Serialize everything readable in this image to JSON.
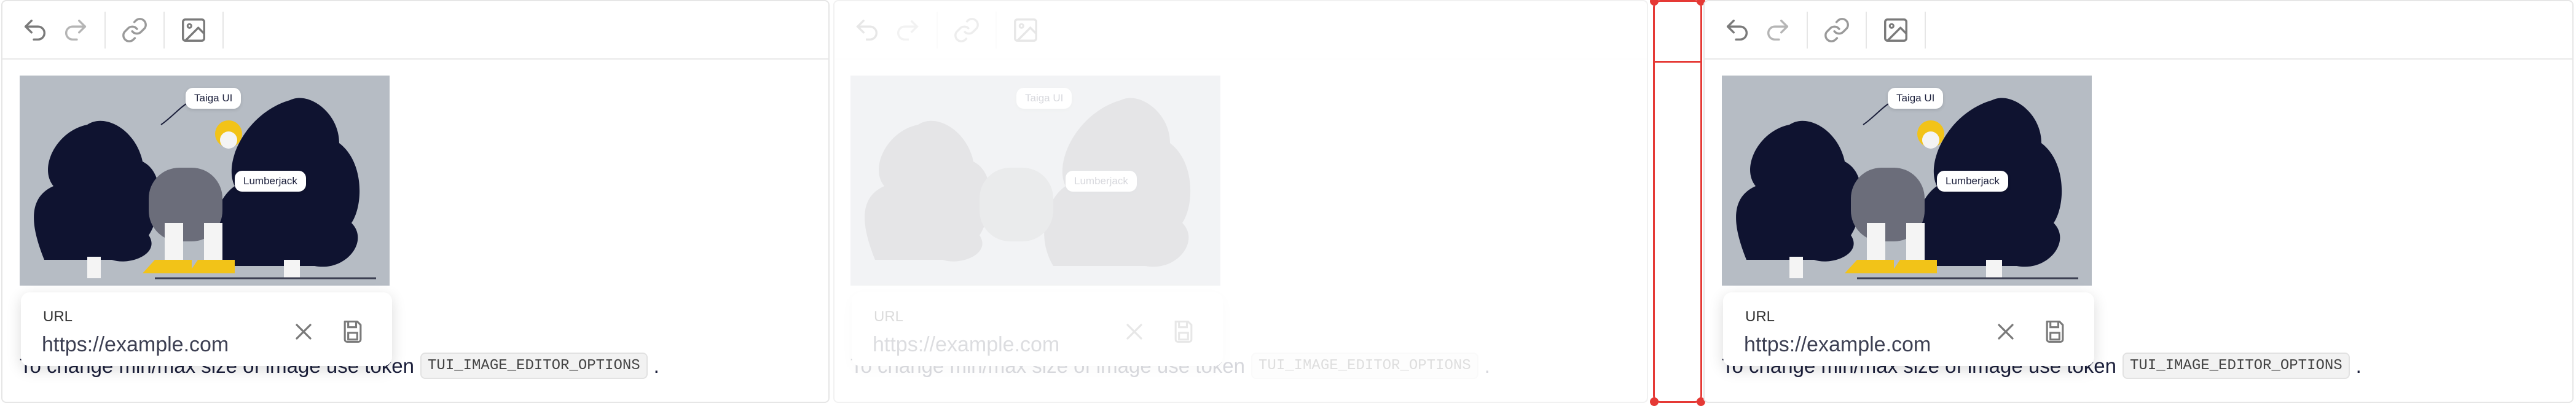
{
  "toolbar": {
    "undo_icon": "undo-icon",
    "redo_icon": "redo-icon",
    "link_icon": "link-icon",
    "image_icon": "image-icon"
  },
  "illustration": {
    "tag_top": "Taiga UI",
    "tag_bottom": "Lumberjack"
  },
  "popup": {
    "label": "URL",
    "value": "https://example.com",
    "close_icon": "close-icon",
    "save_icon": "save-icon"
  },
  "info": {
    "text": "To change min/max size of image use token",
    "token": "TUI_IMAGE_EDITOR_OPTIONS",
    "suffix": "."
  },
  "colors": {
    "accent_red": "#e53935",
    "illustration_bg": "#b6bcc4",
    "tree_dark": "#0f1330",
    "boots_yellow": "#f2c318"
  }
}
